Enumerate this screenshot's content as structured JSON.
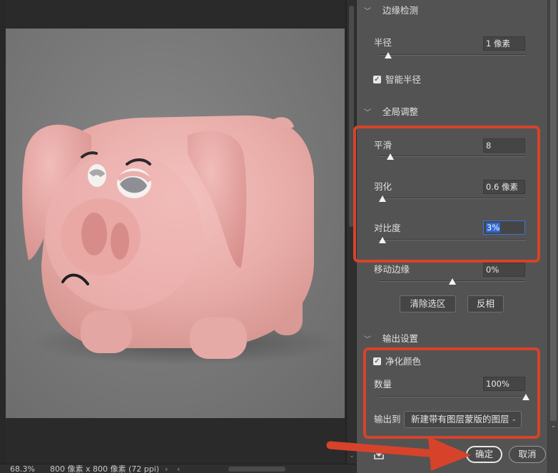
{
  "status_bar": {
    "zoom": "68.3%",
    "doc_info": "800 像素 x 800 像素 (72 ppi)",
    "chevron": "›",
    "left_arrow": "‹"
  },
  "panel": {
    "edge_detection": {
      "header": "边缘检测",
      "radius_label": "半径",
      "radius_value": "1 像素",
      "radius_level_pct": 7,
      "smart_radius_label": "智能半径",
      "smart_radius_checked": true
    },
    "global_refine": {
      "header": "全局调整",
      "smooth_label": "平滑",
      "smooth_value": "8",
      "smooth_level_pct": 8,
      "feather_label": "羽化",
      "feather_value": "0.6 像素",
      "feather_level_pct": 3,
      "contrast_label": "对比度",
      "contrast_value": "3%",
      "contrast_level_pct": 3,
      "shift_edge_label": "移动边缘",
      "shift_edge_value": "0%",
      "shift_edge_level_pct": 50,
      "clear_selection_button": "清除选区",
      "invert_button": "反相"
    },
    "output_settings": {
      "header": "输出设置",
      "decontaminate_label": "净化颜色",
      "decontaminate_checked": true,
      "amount_label": "数量",
      "amount_value": "100%",
      "amount_level_pct": 100,
      "output_to_label": "输出到",
      "output_to_selected": "新建带有图层蒙版的图层"
    },
    "footer": {
      "ok_button": "确定",
      "cancel_button": "取消"
    }
  },
  "colors": {
    "annotation_red": "#d6432a",
    "panel_bg": "#535353",
    "canvas_bg": "#7a7a7a",
    "plush_pink": "#eab0ad"
  },
  "icons": {
    "section_chevron": "chevron-down-icon",
    "export_icon": "save-to-icon",
    "checkbox": "checkbox-checked-icon"
  }
}
